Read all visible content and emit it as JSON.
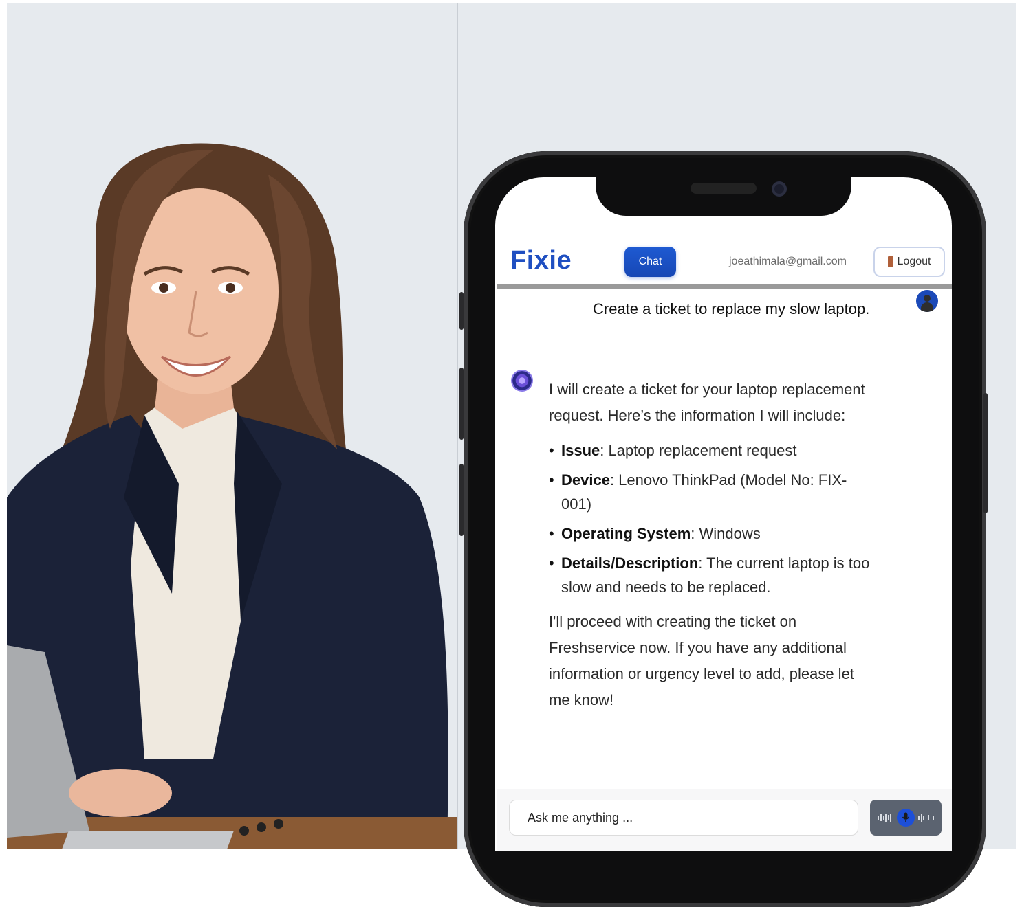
{
  "app": {
    "brand": "Fixie",
    "nav_chat": "Chat",
    "user_email": "joeathimala@gmail.com",
    "logout_label": "Logout"
  },
  "conversation": {
    "user_message": "Create a ticket to replace my slow laptop.",
    "bot_intro": "I will create a ticket for your laptop replacement request. Here’s the information I will include:",
    "bot_items": [
      {
        "label": "Issue",
        "value": ": Laptop replacement request"
      },
      {
        "label": "Device",
        "value": ": Lenovo ThinkPad (Model No: FIX-001)"
      },
      {
        "label": "Operating System",
        "value": ": Windows"
      },
      {
        "label": "Details/Description",
        "value": ": The current laptop is too slow and needs to be replaced."
      }
    ],
    "bot_outro": "I'll proceed with creating the ticket on Freshservice now. If you have any additional information or urgency level to add, please let me know!"
  },
  "input": {
    "placeholder": "Ask me anything ..."
  },
  "icons": {
    "user_avatar": "user-avatar-icon",
    "bot_avatar": "bot-avatar-icon",
    "logout": "door-icon",
    "voice": "microphone-icon"
  },
  "colors": {
    "brand": "#1f4fc1",
    "chat_button": "#1e5ad2",
    "voice_button": "#5b6370",
    "mic": "#1d4fd8"
  }
}
